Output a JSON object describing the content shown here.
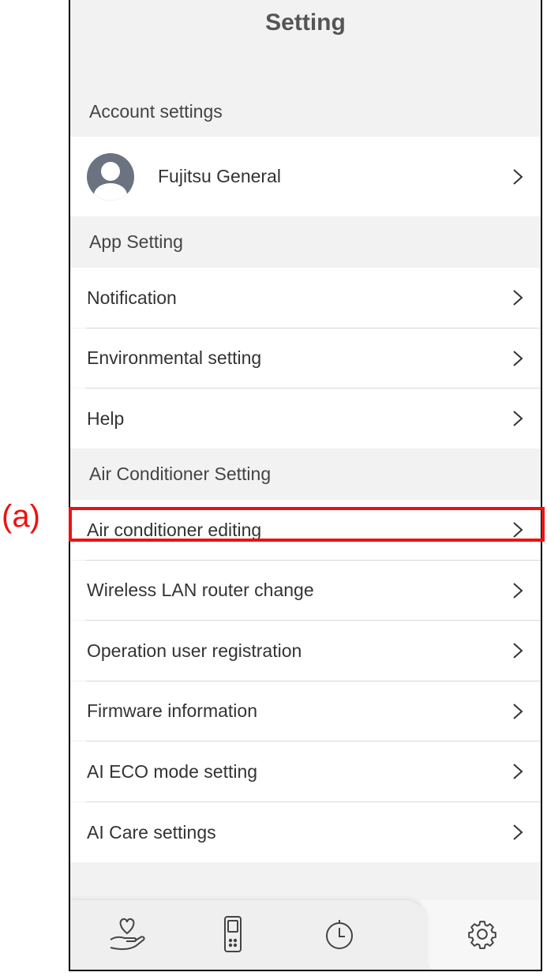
{
  "header": {
    "title": "Setting"
  },
  "sections": {
    "account": {
      "header": "Account settings",
      "user_name": "Fujitsu General"
    },
    "app": {
      "header": "App Setting",
      "items": [
        "Notification",
        "Environmental setting",
        "Help"
      ]
    },
    "air_conditioner": {
      "header": "Air Conditioner Setting",
      "items": [
        "Air conditioner editing",
        "Wireless LAN router change",
        "Operation user registration",
        "Firmware information",
        "AI ECO mode setting",
        "AI Care settings"
      ]
    }
  },
  "annotation": {
    "callout_label": "(a)",
    "highlight_color": "#ee1111"
  },
  "tabbar": {
    "tabs": [
      "care-icon",
      "remote-control-icon",
      "timer-icon",
      "gear-icon"
    ],
    "active": "gear-icon"
  }
}
